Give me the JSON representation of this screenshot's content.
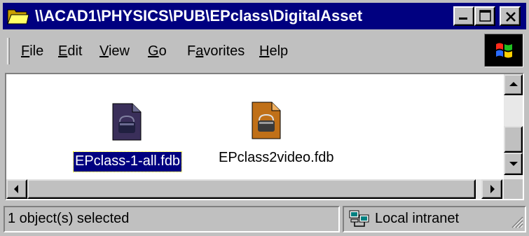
{
  "window": {
    "title": "\\\\ACAD1\\PHYSICS\\PUB\\EPclass\\DigitalAsset",
    "title_icon": "folder-icon",
    "buttons": {
      "minimize": "minimize-icon",
      "maximize": "maximize-icon",
      "close": "close-icon"
    }
  },
  "menu": {
    "items": [
      {
        "label": "File",
        "accel": "F",
        "rest": "ile"
      },
      {
        "label": "Edit",
        "accel": "E",
        "rest": "dit"
      },
      {
        "label": "View",
        "accel": "V",
        "rest": "iew"
      },
      {
        "label": "Go",
        "accel": "G",
        "rest": "o"
      },
      {
        "label": "Favorites",
        "pre": "F",
        "accel": "a",
        "rest": "vorites"
      },
      {
        "label": "Help",
        "accel": "H",
        "rest": "elp"
      }
    ],
    "throbber_icon": "windows-logo-icon"
  },
  "files": [
    {
      "name": "EPclass-1-all.fdb",
      "selected": true,
      "icon": "fdb-file-icon"
    },
    {
      "name": "EPclass2video.fdb",
      "selected": false,
      "icon": "fdb-file-icon"
    }
  ],
  "status": {
    "selection": "1 object(s) selected",
    "zone": "Local intranet",
    "zone_icon": "intranet-icon"
  },
  "colors": {
    "title_bar": "#000080",
    "selection": "#000080",
    "face": "#c0c0c0"
  }
}
